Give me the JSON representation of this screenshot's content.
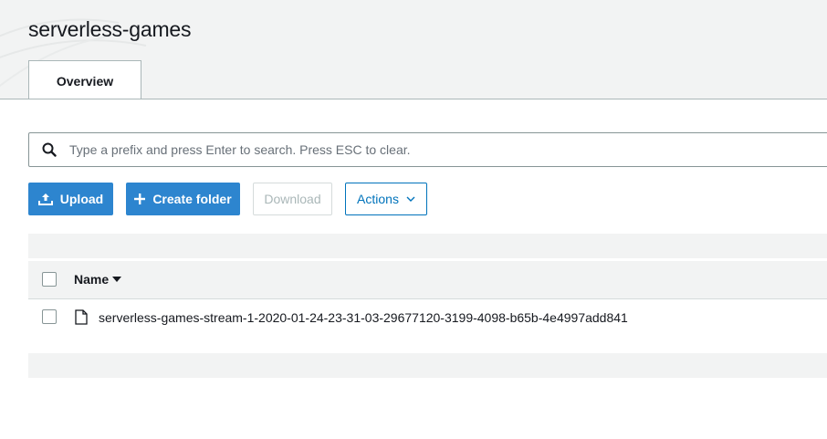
{
  "bucket": {
    "name": "serverless-games"
  },
  "tabs": [
    {
      "label": "Overview"
    }
  ],
  "search": {
    "placeholder": "Type a prefix and press Enter to search. Press ESC to clear.",
    "value": ""
  },
  "toolbar": {
    "upload_label": "Upload",
    "create_folder_label": "Create folder",
    "download_label": "Download",
    "actions_label": "Actions"
  },
  "table": {
    "columns": [
      {
        "label": "Name",
        "sort": "descending"
      }
    ],
    "rows": [
      {
        "name": "serverless-games-stream-1-2020-01-24-23-31-03-29677120-3199-4098-b65b-4e4997add841",
        "icon": "file-icon"
      }
    ]
  },
  "colors": {
    "primary": "#2d85cf",
    "link": "#0073bb",
    "header_bg": "#f2f3f3",
    "disabled": "#aab7b8"
  }
}
